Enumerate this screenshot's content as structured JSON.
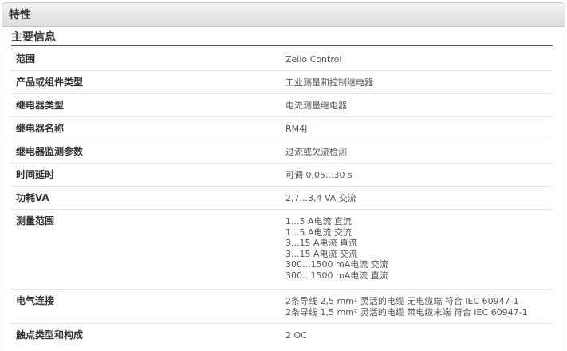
{
  "header": {
    "title": "特性"
  },
  "section": {
    "title": "主要信息"
  },
  "rows": [
    {
      "label": "范围",
      "values": [
        "Zelio Control"
      ]
    },
    {
      "label": "产品或组件类型",
      "values": [
        "工业测量和控制继电器"
      ]
    },
    {
      "label": "继电器类型",
      "values": [
        "电流测量继电器"
      ]
    },
    {
      "label": "继电器名称",
      "values": [
        "RM4J"
      ]
    },
    {
      "label": "继电器监测参数",
      "values": [
        "过流或欠流检测"
      ]
    },
    {
      "label": "时间延时",
      "values": [
        "可调 0,05...30 s"
      ]
    },
    {
      "label": "功耗VA",
      "values": [
        "2,7...3,4 VA 交流"
      ]
    },
    {
      "label": "测量范围",
      "values": [
        "1...5 A电流 直流",
        "1...5 A电流 交流",
        "3...15 A电流 直流",
        "3...15 A电流 交流",
        "300...1500 mA电流 交流",
        "300...1500 mA电流 直流"
      ]
    },
    {
      "label": "电气连接",
      "values": [
        "2条导线 2,5 mm² 灵活的电缆 无电缆端 符合 IEC 60947-1",
        "2条导线 1,5 mm² 灵活的电缆 带电缆末端 符合 IEC 60947-1"
      ]
    },
    {
      "label": "触点类型和构成",
      "values": [
        "2 OC"
      ]
    }
  ]
}
